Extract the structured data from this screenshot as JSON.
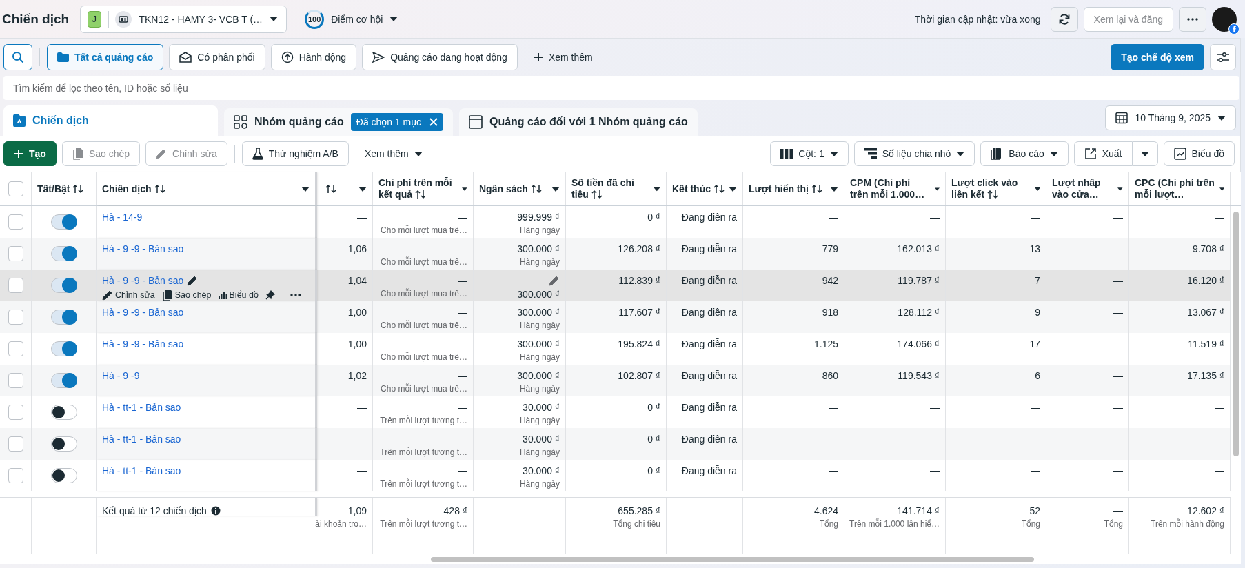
{
  "header": {
    "title": "Chiến dịch",
    "account": {
      "initial": "J",
      "name": "TKN12 - HAMY 3- VCB T (…"
    },
    "score": {
      "value": "100",
      "label": "Điểm cơ hội"
    },
    "update_text": "Thời gian cập nhật: vừa xong",
    "review_button": {
      "label": "Xem lại và đăng",
      "disabled": true
    }
  },
  "filters": {
    "items": [
      {
        "label": "Tất cả quảng cáo",
        "selected": true
      },
      {
        "label": "Có phân phối",
        "selected": false
      },
      {
        "label": "Hành động",
        "selected": false
      },
      {
        "label": "Quảng cáo đang hoạt động",
        "selected": false
      }
    ],
    "more": "Xem thêm",
    "create_view": "Tạo chế độ xem"
  },
  "search": {
    "placeholder": "Tìm kiếm để lọc theo tên, ID hoặc số liệu"
  },
  "tabs": [
    {
      "label": "Chiến dịch",
      "selected": true
    },
    {
      "label": "Nhóm quảng cáo",
      "selected": false,
      "badge": "Đã chọn 1 mục"
    },
    {
      "label": "Quảng cáo đối với 1 Nhóm quảng cáo",
      "selected": false
    }
  ],
  "date": "10 Tháng 9, 2025",
  "toolbar": {
    "left": [
      {
        "label": "Tạo",
        "kind": "primary",
        "disabled": false
      },
      {
        "label": "Sao chép",
        "kind": "plain",
        "disabled": true
      },
      {
        "label": "Chỉnh sửa",
        "kind": "plain",
        "disabled": true
      },
      {
        "label": "Thử nghiệm A/B",
        "kind": "plain",
        "disabled": false
      },
      {
        "label": "Xem thêm",
        "kind": "menu",
        "disabled": false
      }
    ],
    "right": [
      {
        "label": "Cột: 1",
        "kind": "dropdown"
      },
      {
        "label": "Số liệu chia nhỏ",
        "kind": "dropdown"
      },
      {
        "label": "Báo cáo",
        "kind": "dropdown"
      },
      {
        "label": "Xuất",
        "kind": "split"
      },
      {
        "label": "Biểu đồ",
        "kind": "plain"
      }
    ]
  },
  "table": {
    "header_checked": false,
    "toggle_header": {
      "label": "Tất/Bật",
      "sortable": true
    },
    "name_header": {
      "label": "Chiến dịch",
      "sortable": true,
      "menu": true
    },
    "columns": [
      {
        "sortable": true,
        "menu": true
      },
      {
        "label": "Chi phí trên mỗi kết quả",
        "sortable": true,
        "menu": true
      },
      {
        "label": "Ngân sách",
        "sortable": true,
        "menu": true
      },
      {
        "label": "Số tiền đã chi tiêu",
        "sortable": true,
        "menu": true
      },
      {
        "label": "Kết thúc",
        "sortable": true,
        "menu": true
      },
      {
        "label": "Lượt hiển thị",
        "sortable": true,
        "menu": true
      },
      {
        "label": "CPM (Chi phí trên mỗi 1.000…",
        "sortable": false,
        "menu": true
      },
      {
        "label": "Lượt click vào liên kết",
        "sortable": true,
        "menu": true
      },
      {
        "label": "Lượt nhấp vào cửa…",
        "sortable": false,
        "menu": true
      },
      {
        "label": "CPC (Chi phí trên mỗi lượt…",
        "sortable": false,
        "menu": true
      }
    ],
    "rows": [
      {
        "checked": false,
        "on": true,
        "hovered": false,
        "name": "Hà - 14-9",
        "cells": [
          {
            "value": "—"
          },
          {
            "value": "—",
            "sub": "Cho mỗi lượt mua trê…"
          },
          {
            "value": "999.999 ₫",
            "sub": "Hàng ngày"
          },
          {
            "value": "0 ₫"
          },
          {
            "value": "Đang diễn ra"
          },
          {
            "value": "—"
          },
          {
            "value": "—"
          },
          {
            "value": "—"
          },
          {
            "value": "—"
          },
          {
            "value": "—"
          }
        ]
      },
      {
        "checked": false,
        "on": true,
        "hovered": false,
        "name": "Hà - 9 -9 - Bản sao",
        "cells": [
          {
            "value": "1,06"
          },
          {
            "value": "—",
            "sub": "Cho mỗi lượt mua trê…"
          },
          {
            "value": "300.000 ₫",
            "sub": "Hàng ngày"
          },
          {
            "value": "126.208 ₫"
          },
          {
            "value": "Đang diễn ra"
          },
          {
            "value": "779"
          },
          {
            "value": "162.013 ₫"
          },
          {
            "value": "13"
          },
          {
            "value": "—"
          },
          {
            "value": "9.708 ₫"
          }
        ]
      },
      {
        "checked": false,
        "on": true,
        "hovered": true,
        "name": "Hà - 9 -9 - Bản sao",
        "actions": [
          "Chỉnh sửa",
          "Sao chép",
          "Biểu đồ"
        ],
        "cells": [
          {
            "value": "1,04"
          },
          {
            "value": "—",
            "sub": "Cho mỗi lượt mua trê…"
          },
          {
            "value": "300.000 ₫",
            "editable": true
          },
          {
            "value": "112.839 ₫"
          },
          {
            "value": "Đang diễn ra"
          },
          {
            "value": "942"
          },
          {
            "value": "119.787 ₫"
          },
          {
            "value": "7"
          },
          {
            "value": "—"
          },
          {
            "value": "16.120 ₫"
          }
        ]
      },
      {
        "checked": false,
        "on": true,
        "hovered": false,
        "name": "Hà - 9 -9 - Bản sao",
        "cells": [
          {
            "value": "1,00"
          },
          {
            "value": "—",
            "sub": "Cho mỗi lượt mua trê…"
          },
          {
            "value": "300.000 ₫",
            "sub": "Hàng ngày"
          },
          {
            "value": "117.607 ₫"
          },
          {
            "value": "Đang diễn ra"
          },
          {
            "value": "918"
          },
          {
            "value": "128.112 ₫"
          },
          {
            "value": "9"
          },
          {
            "value": "—"
          },
          {
            "value": "13.067 ₫"
          }
        ]
      },
      {
        "checked": false,
        "on": true,
        "hovered": false,
        "name": "Hà - 9 -9 - Bản sao",
        "cells": [
          {
            "value": "1,00"
          },
          {
            "value": "—",
            "sub": "Cho mỗi lượt mua trê…"
          },
          {
            "value": "300.000 ₫",
            "sub": "Hàng ngày"
          },
          {
            "value": "195.824 ₫"
          },
          {
            "value": "Đang diễn ra"
          },
          {
            "value": "1.125"
          },
          {
            "value": "174.066 ₫"
          },
          {
            "value": "17"
          },
          {
            "value": "—"
          },
          {
            "value": "11.519 ₫"
          }
        ]
      },
      {
        "checked": false,
        "on": true,
        "hovered": false,
        "name": "Hà - 9 -9",
        "cells": [
          {
            "value": "1,02"
          },
          {
            "value": "—",
            "sub": "Cho mỗi lượt mua trê…"
          },
          {
            "value": "300.000 ₫",
            "sub": "Hàng ngày"
          },
          {
            "value": "102.807 ₫"
          },
          {
            "value": "Đang diễn ra"
          },
          {
            "value": "860"
          },
          {
            "value": "119.543 ₫"
          },
          {
            "value": "6"
          },
          {
            "value": "—"
          },
          {
            "value": "17.135 ₫"
          }
        ]
      },
      {
        "checked": false,
        "on": false,
        "hovered": false,
        "name": "Hà - tt-1 - Bản sao",
        "cells": [
          {
            "value": "—"
          },
          {
            "value": "—",
            "sub": "Trên mỗi lượt tương t…"
          },
          {
            "value": "30.000 ₫",
            "sub": "Hàng ngày"
          },
          {
            "value": "0 ₫"
          },
          {
            "value": "Đang diễn ra"
          },
          {
            "value": "—"
          },
          {
            "value": "—"
          },
          {
            "value": "—"
          },
          {
            "value": "—"
          },
          {
            "value": "—"
          }
        ]
      },
      {
        "checked": false,
        "on": false,
        "hovered": false,
        "name": "Hà - tt-1 - Bản sao",
        "cells": [
          {
            "value": "—"
          },
          {
            "value": "—",
            "sub": "Trên mỗi lượt tương t…"
          },
          {
            "value": "30.000 ₫",
            "sub": "Hàng ngày"
          },
          {
            "value": "0 ₫"
          },
          {
            "value": "Đang diễn ra"
          },
          {
            "value": "—"
          },
          {
            "value": "—"
          },
          {
            "value": "—"
          },
          {
            "value": "—"
          },
          {
            "value": "—"
          }
        ]
      },
      {
        "checked": false,
        "on": false,
        "hovered": false,
        "name": "Hà - tt-1 - Bản sao",
        "cells": [
          {
            "value": "—"
          },
          {
            "value": "—",
            "sub": "Trên mỗi lượt tương t…"
          },
          {
            "value": "30.000 ₫",
            "sub": "Hàng ngày"
          },
          {
            "value": "0 ₫"
          },
          {
            "value": "Đang diễn ra"
          },
          {
            "value": "—"
          },
          {
            "value": "—"
          },
          {
            "value": "—"
          },
          {
            "value": "—"
          },
          {
            "value": "—"
          }
        ]
      }
    ],
    "summary": {
      "label": "Kết quả từ 12 chiến dịch",
      "cells": [
        {
          "value": "1,09",
          "sub": "ài khoản tro…"
        },
        {
          "value": "428 ₫",
          "sub": "Trên mỗi lượt tương t…"
        },
        {},
        {
          "value": "655.285 ₫",
          "sub": "Tổng chi tiêu"
        },
        {},
        {
          "value": "4.624",
          "sub": "Tổng"
        },
        {
          "value": "141.714 ₫",
          "sub": "Trên mỗi 1.000 lần hiể…"
        },
        {
          "value": "52",
          "sub": "Tổng"
        },
        {
          "value": "—",
          "sub": "Tổng"
        },
        {
          "value": "12.602 ₫",
          "sub": "Trên mỗi hành động"
        }
      ]
    }
  }
}
